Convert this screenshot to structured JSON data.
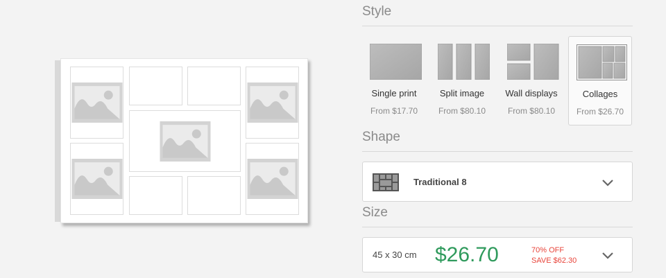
{
  "style": {
    "title": "Style",
    "options": [
      {
        "label": "Single print",
        "price": "From $17.70"
      },
      {
        "label": "Split image",
        "price": "From $80.10"
      },
      {
        "label": "Wall displays",
        "price": "From $80.10"
      },
      {
        "label": "Collages",
        "price": "From $26.70",
        "selected": true
      }
    ]
  },
  "shape": {
    "title": "Shape",
    "selected": "Traditional 8"
  },
  "size": {
    "title": "Size",
    "selected": "45 x 30 cm",
    "price": "$26.70",
    "discount": "70% OFF",
    "saving": "SAVE $62.30"
  },
  "colors": {
    "price_green": "#2f9a5c",
    "discount_red": "#e8443a",
    "placeholder_gray": "#d3d3d3"
  }
}
